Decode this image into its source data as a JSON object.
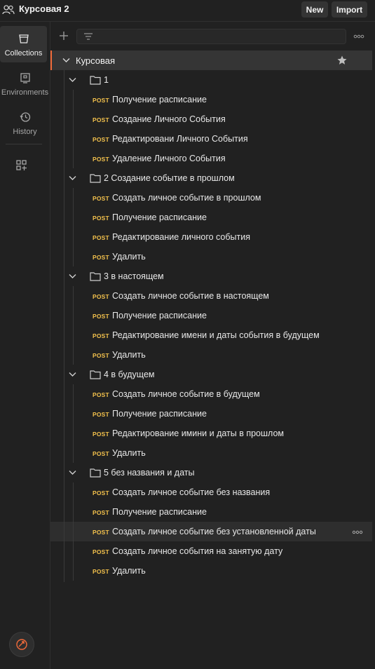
{
  "header": {
    "workspace_title": "Курсовая 2",
    "new_label": "New",
    "import_label": "Import"
  },
  "sidebar": {
    "items": [
      {
        "label": "Collections",
        "icon": "collections-icon",
        "active": true
      },
      {
        "label": "Environments",
        "icon": "environments-icon",
        "active": false
      },
      {
        "label": "History",
        "icon": "history-icon",
        "active": false
      }
    ]
  },
  "toolbar": {
    "search_placeholder": ""
  },
  "collection": {
    "name": "Курсовая",
    "folders": [
      {
        "name": "1",
        "requests": [
          {
            "method": "POST",
            "name": "Получение расписание"
          },
          {
            "method": "POST",
            "name": "Создание Личного События"
          },
          {
            "method": "POST",
            "name": "Редактировани Личного События"
          },
          {
            "method": "POST",
            "name": "Удаление Личного События"
          }
        ]
      },
      {
        "name": "2 Создание событие в прошлом",
        "requests": [
          {
            "method": "POST",
            "name": "Создать личное событие в прошлом"
          },
          {
            "method": "POST",
            "name": "Получение расписание"
          },
          {
            "method": "POST",
            "name": "Редактирование личного события"
          },
          {
            "method": "POST",
            "name": "Удалить"
          }
        ]
      },
      {
        "name": "3 в настоящем",
        "requests": [
          {
            "method": "POST",
            "name": "Создать личное событие в настоящем"
          },
          {
            "method": "POST",
            "name": "Получение расписание"
          },
          {
            "method": "POST",
            "name": "Редактирование имени и даты события в будущем"
          },
          {
            "method": "POST",
            "name": "Удалить"
          }
        ]
      },
      {
        "name": "4 в будущем",
        "requests": [
          {
            "method": "POST",
            "name": "Создать личное событие в будущем"
          },
          {
            "method": "POST",
            "name": "Получение расписание"
          },
          {
            "method": "POST",
            "name": "Редактирование имини и даты в прошлом"
          },
          {
            "method": "POST",
            "name": "Удалить"
          }
        ]
      },
      {
        "name": "5 без названия и даты",
        "requests": [
          {
            "method": "POST",
            "name": "Создать личное событие без названия"
          },
          {
            "method": "POST",
            "name": "Получение расписание"
          },
          {
            "method": "POST",
            "name": "Создать личное событие без установленной даты",
            "hovered": true
          },
          {
            "method": "POST",
            "name": "Создать личное события на занятую дату"
          },
          {
            "method": "POST",
            "name": "Удалить"
          }
        ]
      }
    ]
  },
  "colors": {
    "accent": "#f26b3a",
    "post_method": "#f3c14c",
    "background": "#212121"
  }
}
